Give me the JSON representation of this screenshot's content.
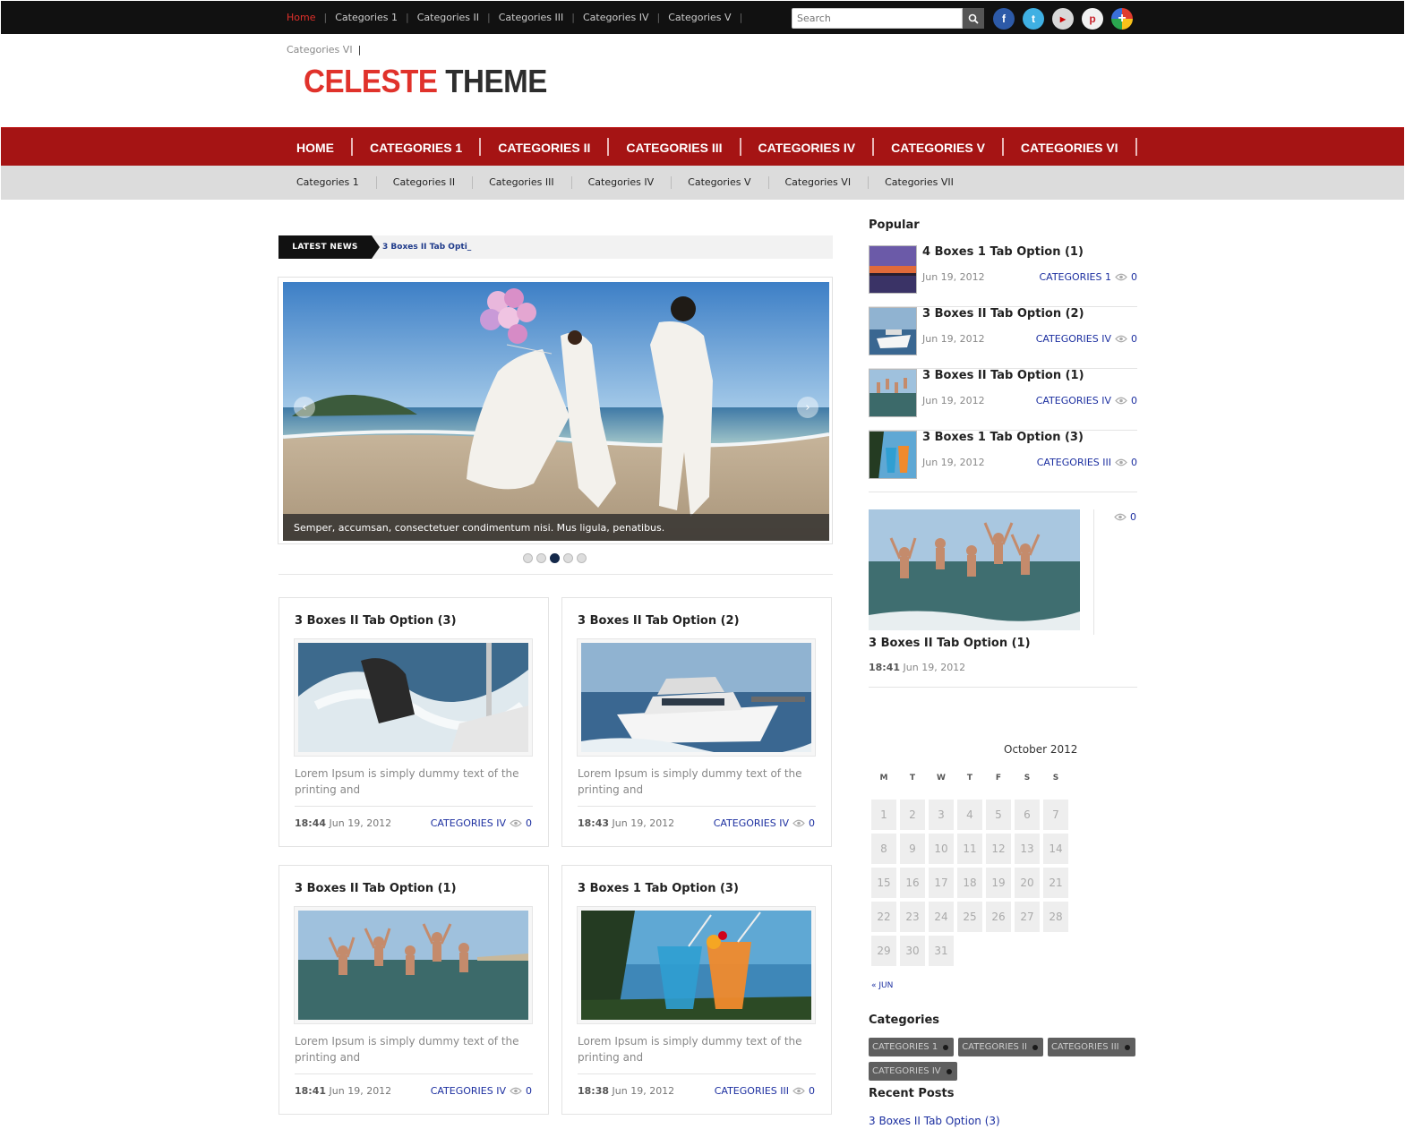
{
  "topbar": {
    "nav": [
      "Home",
      "Categories 1",
      "Categories II",
      "Categories III",
      "Categories IV",
      "Categories V"
    ],
    "nav_overflow": "Categories VI",
    "search_placeholder": "Search",
    "socials": [
      "facebook-icon",
      "twitter-icon",
      "youtube-icon",
      "pinterest-icon",
      "google-plus-icon"
    ]
  },
  "logo": {
    "part1": "CELESTE",
    "part2": "THEME",
    "accent": "#e0322b"
  },
  "main_nav": [
    "HOME",
    "CATEGORIES 1",
    "CATEGORIES II",
    "CATEGORIES III",
    "CATEGORIES IV",
    "CATEGORIES V",
    "CATEGORIES VI"
  ],
  "sub_nav": [
    "Categories 1",
    "Categories II",
    "Categories III",
    "Categories IV",
    "Categories V",
    "Categories VI",
    "Categories VII"
  ],
  "latest_news": {
    "label": "LATEST NEWS",
    "ticker": "3 Boxes II Tab Opti_"
  },
  "slider": {
    "caption": "Semper, accumsan, consectetuer condimentum nisi. Mus ligula, penatibus.",
    "prev": "‹",
    "next": "›",
    "dot_count": 5,
    "active_dot": 3
  },
  "cards": [
    {
      "title": "3 Boxes II Tab Option (3)",
      "image": "sailing-photo",
      "desc": "Lorem Ipsum is simply dummy text of the printing and",
      "time": "18:44",
      "date": "Jun 19, 2012",
      "category": "CATEGORIES IV",
      "views": "0"
    },
    {
      "title": "3 Boxes II Tab Option (2)",
      "image": "yacht-photo",
      "desc": "Lorem Ipsum is simply dummy text of the printing and",
      "time": "18:43",
      "date": "Jun 19, 2012",
      "category": "CATEGORIES IV",
      "views": "0"
    },
    {
      "title": "3 Boxes II Tab Option (1)",
      "image": "jumping-friends-photo",
      "desc": "Lorem Ipsum is simply dummy text of the printing and",
      "time": "18:41",
      "date": "Jun 19, 2012",
      "category": "CATEGORIES IV",
      "views": "0"
    },
    {
      "title": "3 Boxes 1 Tab Option (3)",
      "image": "cocktails-photo",
      "desc": "Lorem Ipsum is simply dummy text of the printing and",
      "time": "18:38",
      "date": "Jun 19, 2012",
      "category": "CATEGORIES III",
      "views": "0"
    }
  ],
  "sidebar": {
    "popular_title": "Popular",
    "popular": [
      {
        "title": "4 Boxes 1 Tab Option (1)",
        "date": "Jun 19, 2012",
        "category": "CATEGORIES 1",
        "views": "0",
        "image": "sunset-pier-photo"
      },
      {
        "title": "3 Boxes II Tab Option (2)",
        "date": "Jun 19, 2012",
        "category": "CATEGORIES IV",
        "views": "0",
        "image": "yacht-photo"
      },
      {
        "title": "3 Boxes II Tab Option (1)",
        "date": "Jun 19, 2012",
        "category": "CATEGORIES IV",
        "views": "0",
        "image": "jumping-friends-photo"
      },
      {
        "title": "3 Boxes 1 Tab Option (3)",
        "date": "Jun 19, 2012",
        "category": "CATEGORIES III",
        "views": "0",
        "image": "cocktails-photo"
      }
    ],
    "featured": {
      "title": "3 Boxes II Tab Option (1)",
      "time": "18:41",
      "date": "Jun 19, 2012",
      "views": "0"
    },
    "calendar": {
      "caption": "October 2012",
      "weekdays": [
        "M",
        "T",
        "W",
        "T",
        "F",
        "S",
        "S"
      ],
      "days": [
        "1",
        "2",
        "3",
        "4",
        "5",
        "6",
        "7",
        "8",
        "9",
        "10",
        "11",
        "12",
        "13",
        "14",
        "15",
        "16",
        "17",
        "18",
        "19",
        "20",
        "21",
        "22",
        "23",
        "24",
        "25",
        "26",
        "27",
        "28",
        "29",
        "30",
        "31"
      ],
      "prev": "« JUN"
    },
    "categories_title": "Categories",
    "categories": [
      "CATEGORIES 1",
      "CATEGORIES II",
      "CATEGORIES III",
      "CATEGORIES IV"
    ],
    "recent_title": "Recent Posts",
    "recent": [
      "3 Boxes II Tab Option (3)"
    ]
  }
}
